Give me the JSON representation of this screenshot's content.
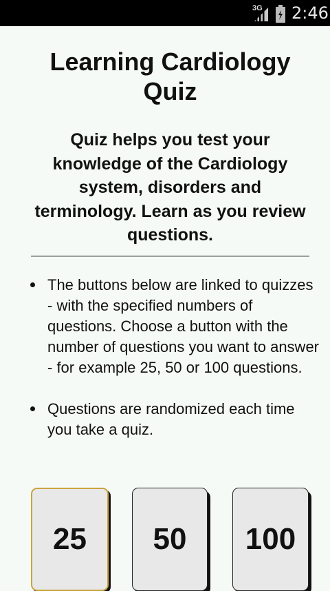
{
  "status_bar": {
    "network": "3G",
    "time": "2:46",
    "icons": [
      "signal-icon",
      "battery-icon"
    ]
  },
  "main": {
    "title": "Learning Cardiology Quiz",
    "intro": "Quiz helps you test your knowledge of the Cardiology system, disorders and terminology. Learn as you review questions.",
    "bullets": [
      "The buttons below are linked to quizzes - with the specified numbers of questions.  Choose a button with the number of questions you want to answer - for example 25, 50 or 100 questions.",
      "Questions are randomized each time you take a quiz."
    ],
    "quiz_buttons": [
      {
        "label": "25",
        "focused": true
      },
      {
        "label": "50",
        "focused": false
      },
      {
        "label": "100",
        "focused": false
      }
    ]
  },
  "colors": {
    "background": "#f6faf6",
    "status_bar": "#000000",
    "button_fill": "#e8e8e8",
    "focus_outline": "#caa440"
  }
}
